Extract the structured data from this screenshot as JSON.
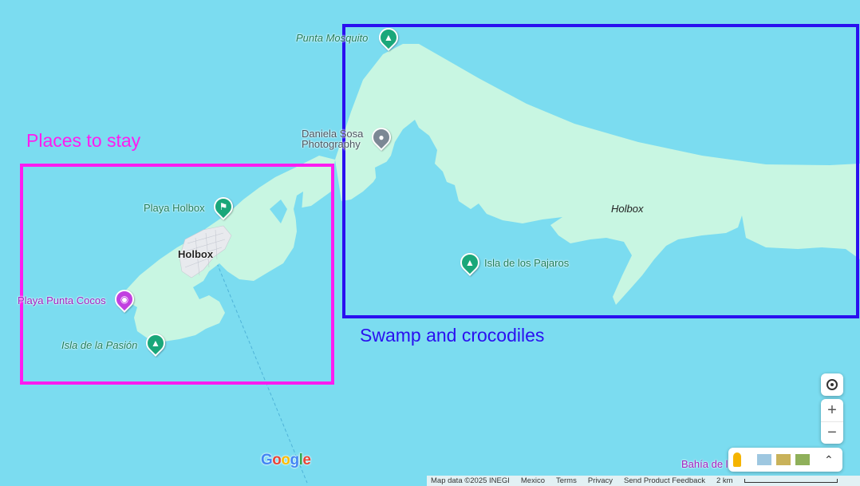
{
  "colors": {
    "water": "#7bdcf0",
    "land": "#c8f6e2",
    "pink": "#ff1cf0",
    "blue": "#2a10f0",
    "poi_green": "#1aa77a"
  },
  "annotations": {
    "places_to_stay": "Places to stay",
    "swamp": "Swamp and crocodiles"
  },
  "map_labels": {
    "punta_mosquito": "Punta Mosquito",
    "daniela_line1": "Daniela Sosa",
    "daniela_line2": "Photography",
    "playa_holbox": "Playa Holbox",
    "holbox_town": "Holbox",
    "holbox_region": "Holbox",
    "playa_punta_cocos": "Playa Punta Cocos",
    "isla_pasion": "Isla de la Pasión",
    "isla_pajaros": "Isla de los Pajaros",
    "bahia": "Bahía de l"
  },
  "icons": {
    "park": "tree-icon",
    "beach": "beach-icon",
    "camera": "camera-icon",
    "place": "place-dot-icon"
  },
  "controls": {
    "zoom_in": "+",
    "zoom_out": "−",
    "expand": "»"
  },
  "footer": {
    "map_data": "Map data ©2025 INEGI",
    "country": "Mexico",
    "terms": "Terms",
    "privacy": "Privacy",
    "feedback": "Send Product Feedback",
    "scale": "2 km"
  },
  "logo": "Google"
}
